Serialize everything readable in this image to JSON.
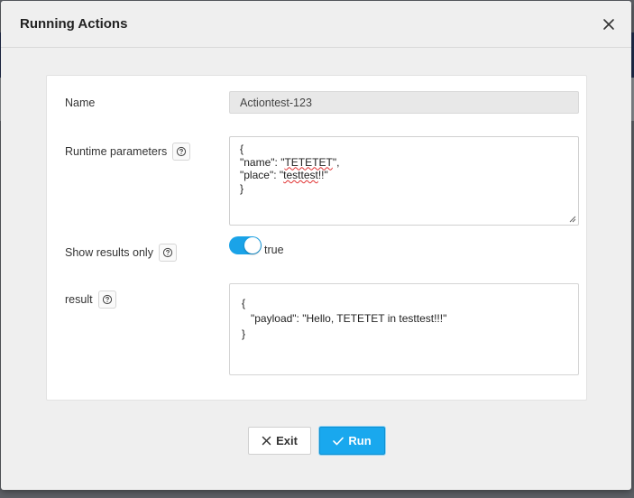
{
  "dialog": {
    "title": "Running Actions"
  },
  "form": {
    "name_label": "Name",
    "name_value": "Actiontest-123",
    "runtime_label": "Runtime parameters",
    "runtime_lines": [
      "{",
      "\"name\": \"TETETET\",",
      "\"place\": \"testtest!!\"",
      "}"
    ],
    "show_results_label": "Show results only",
    "show_results_on": true,
    "show_results_value": "true",
    "result_label": "result",
    "result_lines": [
      "{",
      "   \"payload\": \"Hello, TETETET in testtest!!!\"",
      "}"
    ]
  },
  "buttons": {
    "exit_label": "Exit",
    "run_label": "Run"
  },
  "colors": {
    "accent": "#19a8ee",
    "toggle_on": "#1aa3e8"
  },
  "icons": {
    "close": "close-icon",
    "help": "help-circle-icon",
    "exit": "x-icon",
    "run": "check-icon"
  }
}
